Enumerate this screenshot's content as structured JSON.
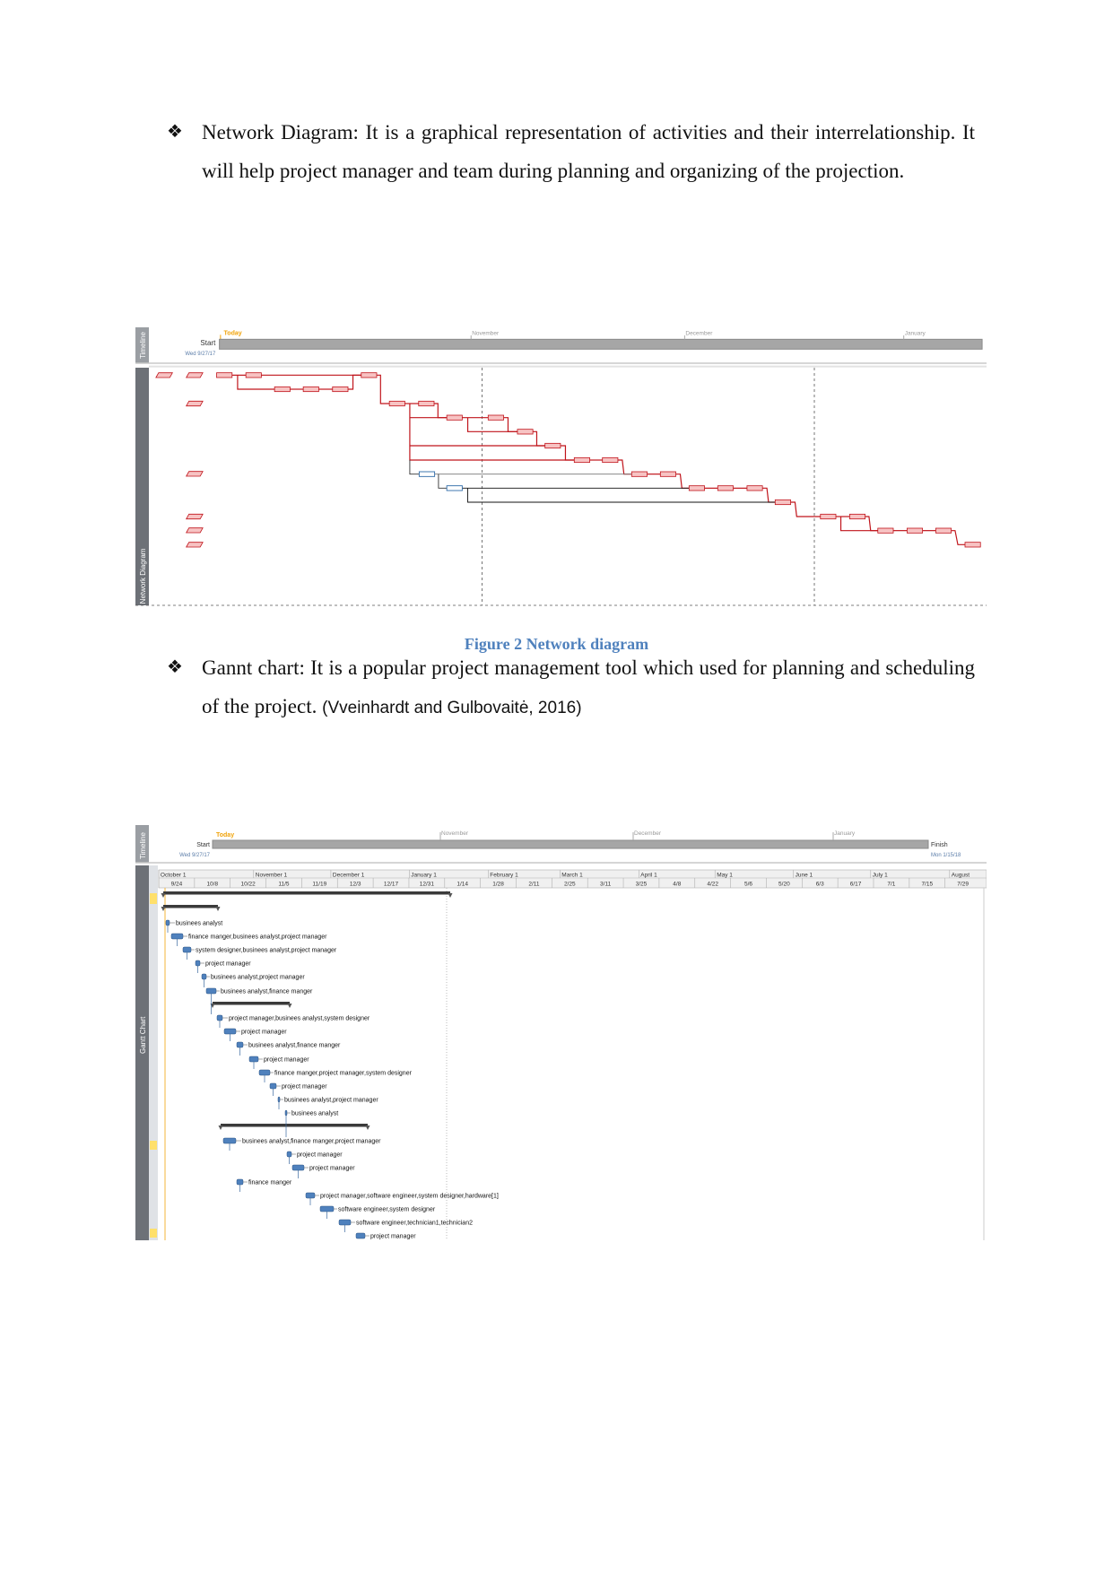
{
  "paragraphs": {
    "network": {
      "bullet": "❖",
      "text": "Network Diagram: It is a graphical representation of activities and their interrelationship. It will help project manager and team during planning and organizing of the projection."
    },
    "gantt": {
      "bullet": "❖",
      "text": "Gannt chart: It is a popular project management tool which used for planning and scheduling of the project.",
      "citation": "(Vveinhardt and Gulbovaitė, 2016)"
    }
  },
  "network_figure": {
    "caption": "Figure 2 Network diagram",
    "timeline_label": "Timeline",
    "view_label": "Network Diagram",
    "today": "Today",
    "start": "Start",
    "start_date": "Wed 9/27/17",
    "months": [
      "November",
      "December",
      "January"
    ],
    "colors": {
      "critical": "#c0141b",
      "critical_fill": "#f7c3c3",
      "noncritical": "#2e6aa8",
      "today": "#f0a30a"
    }
  },
  "gantt_figure": {
    "timeline_label": "Timeline",
    "view_label": "Gantt Chart",
    "today": "Today",
    "start": "Start",
    "start_date": "Wed 9/27/17",
    "finish": "Finish",
    "finish_date": "Mon 1/15/18",
    "timeline_months": [
      "November",
      "December",
      "January"
    ],
    "scale_months": [
      "October 1",
      "November 1",
      "December 1",
      "January 1",
      "February 1",
      "March 1",
      "April 1",
      "May 1",
      "June 1",
      "July 1",
      "August"
    ],
    "scale_weeks": [
      "9/24",
      "10/8",
      "10/22",
      "11/5",
      "11/19",
      "12/3",
      "12/17",
      "12/31",
      "1/14",
      "1/28",
      "2/11",
      "2/25",
      "3/11",
      "3/25",
      "4/8",
      "4/22",
      "5/6",
      "5/20",
      "6/3",
      "6/17",
      "7/1",
      "7/15",
      "7/29"
    ],
    "task_resources": [
      "businees analyst",
      "finance manger,businees analyst,project manager",
      "system designer,businees analyst,project manager",
      "project manager",
      "businees analyst,project manager",
      "businees analyst,finance manger",
      "project manager,businees analyst,system designer",
      "project manager",
      "businees analyst,finance manger",
      "project manager",
      "finance manger,project manager,system designer",
      "project manager",
      "businees analyst,project manager",
      "businees analyst",
      "businees analyst,finance manger,project manager",
      "project manager",
      "project manager",
      "finance manger",
      "project manager,software engineer,system designer,hardware[1]",
      "software engineer,system designer",
      "software engineer,technician1,technician2",
      "project manager"
    ],
    "colors": {
      "task_bar": "#4f81bd",
      "summary_bar": "#3a3a3a",
      "today": "#f0a30a"
    }
  }
}
